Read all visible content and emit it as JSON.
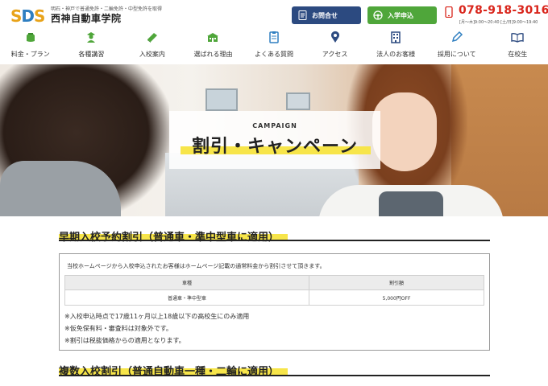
{
  "header": {
    "logo": {
      "s1": "S",
      "d": "D",
      "s2": "S"
    },
    "tagline": "明石・神戸で普通免許・二輪免許・中型免許を取得",
    "school_name": "西神自動車学院",
    "contact_label": "お問合せ",
    "apply_label": "入学申込",
    "phone": "078-918-3016",
    "hours": "[月〜木]9:00〜20:40 [土/日]9:00〜19:40"
  },
  "nav": {
    "items": [
      {
        "label": "料金・プラン",
        "icon": "wallet-icon"
      },
      {
        "label": "各種講習",
        "icon": "instructor-icon"
      },
      {
        "label": "入校案内",
        "icon": "book-icon"
      },
      {
        "label": "選ばれる理由",
        "icon": "school-building-icon"
      },
      {
        "label": "よくある質問",
        "icon": "clipboard-icon"
      },
      {
        "label": "アクセス",
        "icon": "map-pin-icon"
      },
      {
        "label": "法人のお客様",
        "icon": "office-building-icon"
      },
      {
        "label": "採用について",
        "icon": "pencil-icon"
      },
      {
        "label": "在校生",
        "icon": "open-book-icon"
      }
    ]
  },
  "hero": {
    "subtitle": "CAMPAIGN",
    "title": "割引・キャンペーン"
  },
  "section1": {
    "title": "早期入校予約割引（普通車・準中型車に適用）",
    "intro": "当校ホームページから入校申込されたお客様はホームページ記載の通常料金から割引させて頂きます。",
    "table": {
      "headers": [
        "車種",
        "割引額"
      ],
      "rows": [
        [
          "普通車・準中型車",
          "5,000円OFF"
        ]
      ]
    },
    "notes": [
      "※入校申込時点で17歳11ヶ月以上18歳以下の高校生にのみ適用",
      "※仮免保有料・審査料は対象外です。",
      "※割引は税抜価格からの適用となります。"
    ]
  },
  "section2": {
    "title": "複数入校割引（普通自動車一種・二輪に適用）"
  },
  "colors": {
    "navy": "#2c4a80",
    "green": "#4fa63a",
    "red": "#d9261c",
    "highlight": "#f7e54a",
    "nav_icon": "#2f7fc1"
  }
}
